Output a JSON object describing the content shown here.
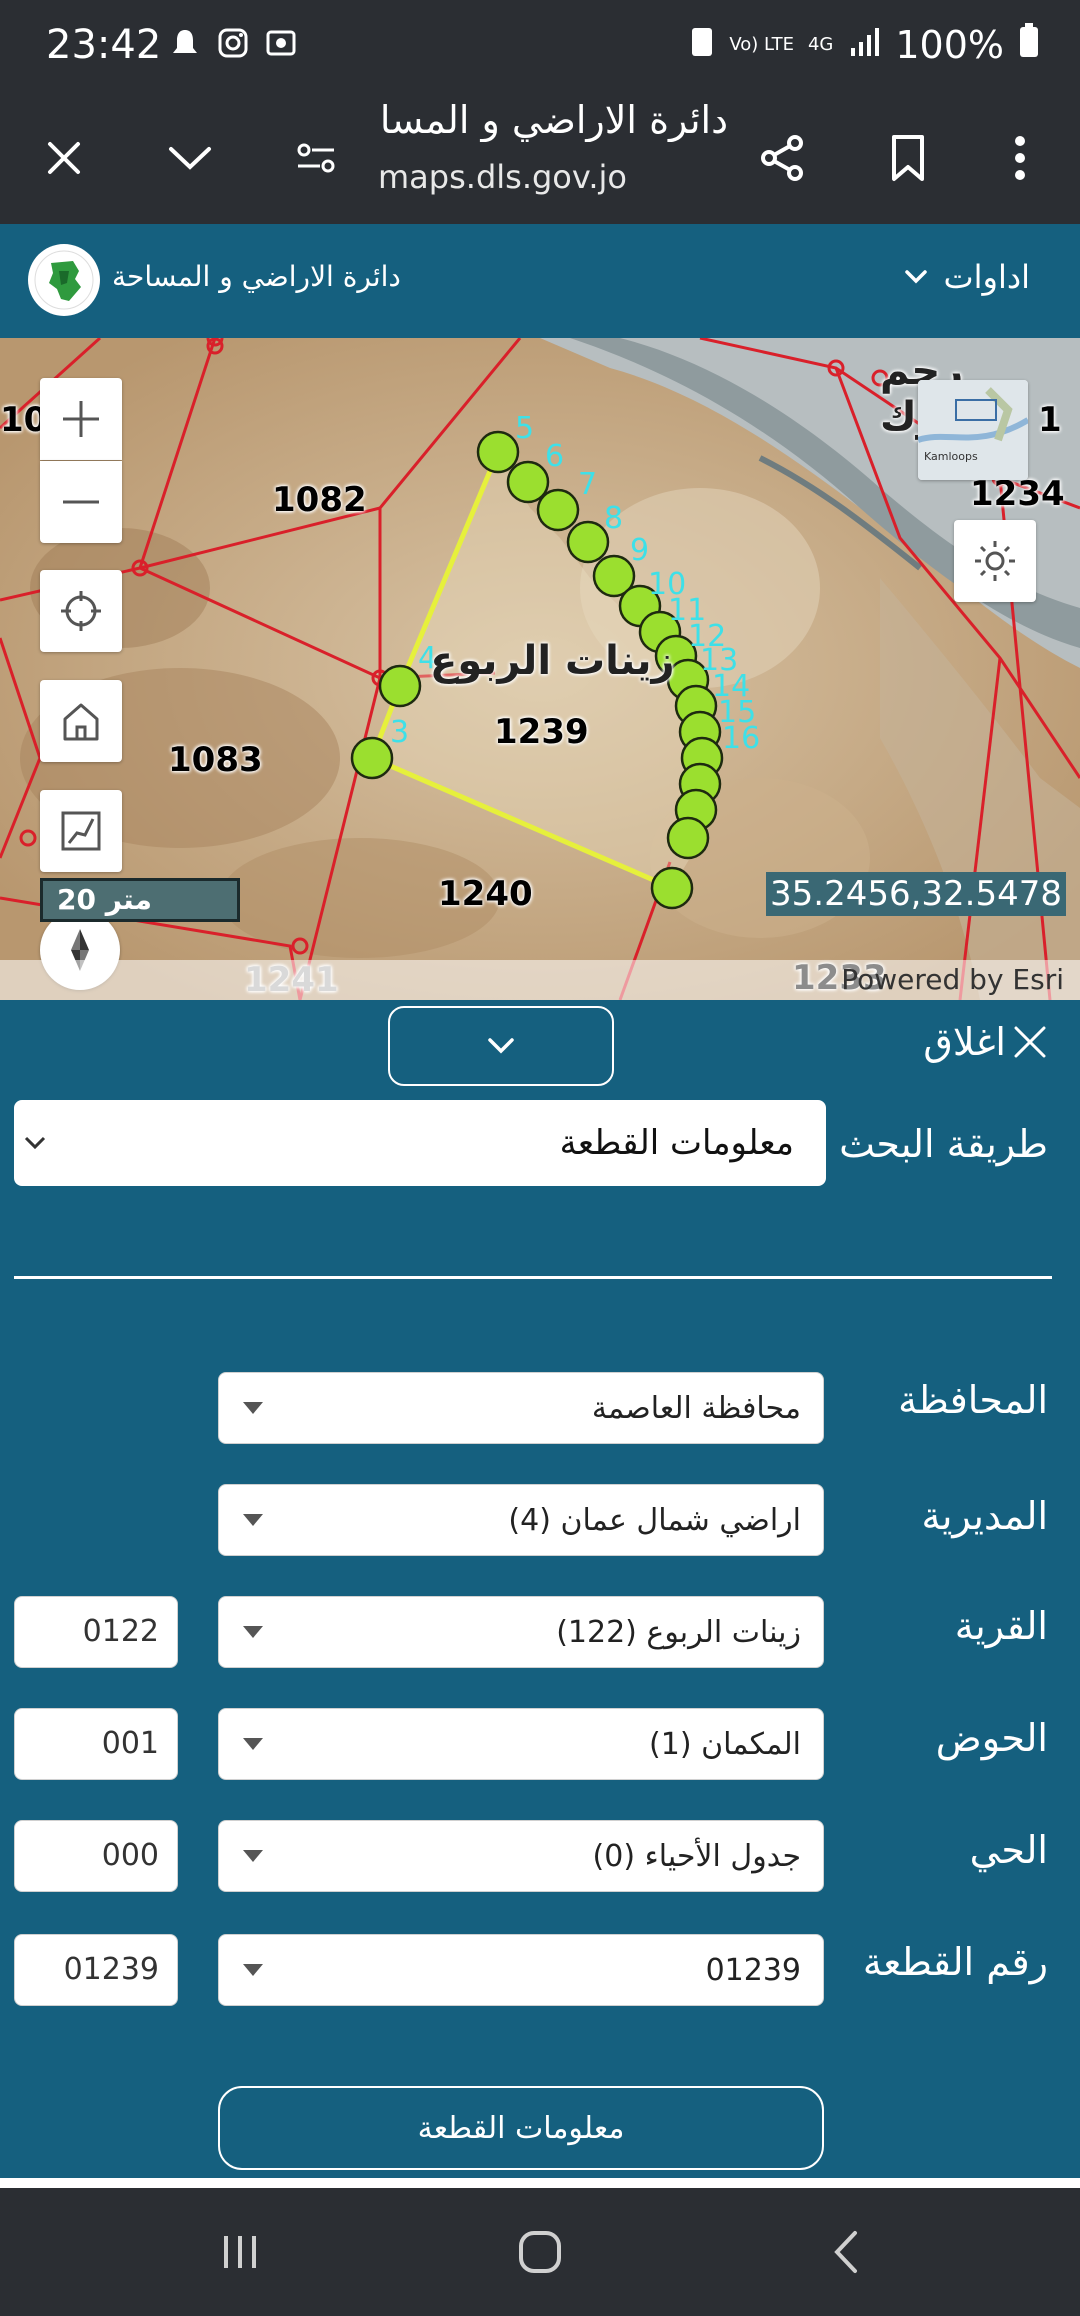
{
  "status_bar": {
    "time": "23:42",
    "left_icons": [
      "notification-icon",
      "instagram-icon",
      "photo-icon"
    ],
    "network": "4G",
    "volte": "Vo) LTE",
    "battery": "100%"
  },
  "browser": {
    "title": "دائرة الاراضي و المسا...",
    "url": "maps.dls.gov.jo"
  },
  "app_header": {
    "org_name": "دائرة الاراضي و المساحة",
    "tools_label": "اداوات"
  },
  "map": {
    "parcel_labels": [
      "1082",
      "1083",
      "1239",
      "1240",
      "1241",
      "1234",
      "10",
      "1",
      "1233"
    ],
    "area_name": "زينات الربوع",
    "area_name_top": "رجم الشوك",
    "vertex_numbers": [
      "3",
      "4",
      "5",
      "6",
      "7",
      "8",
      "9",
      "10",
      "11",
      "12",
      "13",
      "14",
      "15",
      "16"
    ],
    "scale_label": "20 متر",
    "coordinates": "35.2456,32.5478",
    "attribution": "Powered by Esri",
    "overview_label": "Kamloops"
  },
  "panel": {
    "close_label": "اغلاق",
    "search_method_label": "طريقة البحث",
    "search_method_value": "معلومات القطعة",
    "governorate_label": "المحافظة",
    "governorate_value": "محافظة العاصمة",
    "directorate_label": "المديرية",
    "directorate_value": "اراضي شمال عمان (4)",
    "village_label": "القرية",
    "village_value": "زينات الربوع (122)",
    "village_code": "0122",
    "basin_label": "الحوض",
    "basin_value": "المكمان (1)",
    "basin_code": "001",
    "district_label": "الحي",
    "district_value": "جدول الأحياء (0)",
    "district_code": "000",
    "parcel_label": "رقم القطعة",
    "parcel_value": "01239",
    "parcel_code": "01239",
    "submit_label": "معلومات القطعة"
  },
  "colors": {
    "header_bg": "#2b2e33",
    "panel_bg": "#15607f",
    "parcel_line": "#d9202a",
    "highlight": "#e6f03c",
    "vertex_fill": "#9bdf2f",
    "vertex_number": "#3ee0e8"
  }
}
